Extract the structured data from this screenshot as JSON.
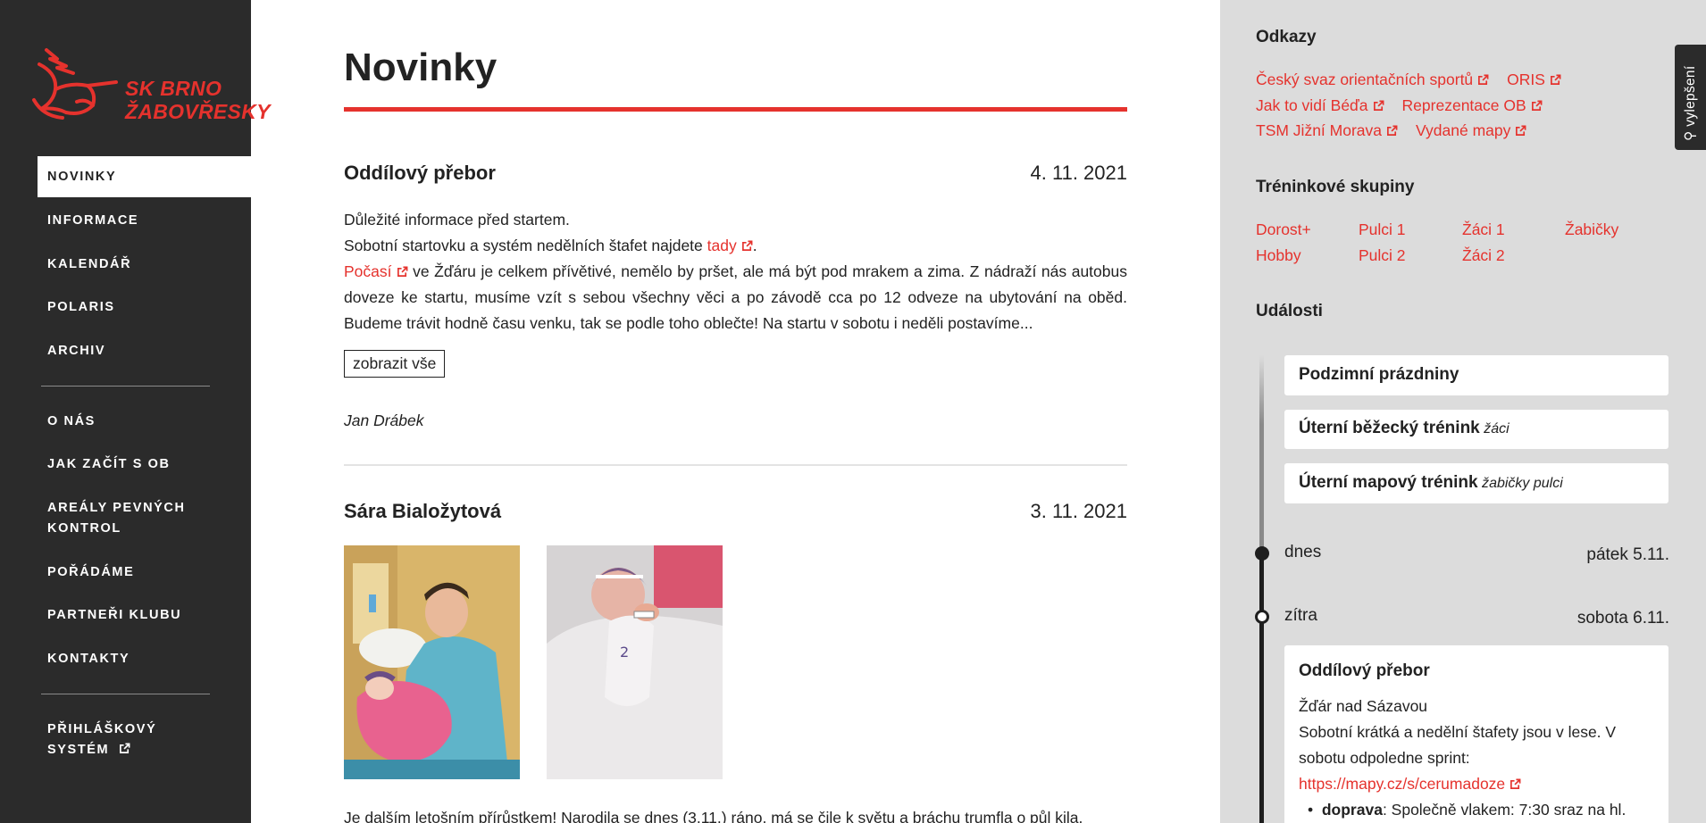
{
  "sidebar": {
    "logo_text_line1": "SK BRNO",
    "logo_text_line2": "ŽABOVŘESKY",
    "nav": [
      "NOVINKY",
      "INFORMACE",
      "KALENDÁŘ",
      "POLARIS",
      "ARCHIV",
      "O NÁS",
      "JAK ZAČÍT S OB",
      "AREÁLY PEVNÝCH",
      "KONTROL",
      "POŘÁDÁME",
      "PARTNEŘI KLUBU",
      "KONTAKTY",
      "PŘIHLÁŠKOVÝ",
      "SYSTÉM"
    ]
  },
  "main": {
    "title": "Novinky",
    "posts": [
      {
        "title": "Oddílový přebor",
        "date": "4. 11. 2021",
        "line1": "Důležité informace před startem.",
        "line2_before": "Sobotní startovku a systém nedělních štafet najdete ",
        "line2_link": "tady",
        "line2_after": ".",
        "line3_link": "Počasí",
        "line3_text": " ve Žďáru je celkem přívětivé, nemělo by pršet, ale má být pod mrakem a zima. Z nádraží nás autobus doveze ke startu, musíme vzít s sebou všechny věci a po závodě cca po 12 odveze na ubytování na oběd. Budeme trávit hodně času venku, tak se podle toho oblečte! Na startu v sobotu i neděli postavíme...",
        "show_all": "zobrazit vše",
        "author": "Jan Drábek"
      },
      {
        "title": "Sára Bialožytová",
        "date": "3. 11. 2021",
        "body": "Je dalším letošním přírůstkem! Narodila se dnes (3.11.) ráno, má se čile k světu a bráchu trumfla o půl kila."
      }
    ]
  },
  "aside": {
    "links_heading": "Odkazy",
    "links": [
      [
        "Český svaz orientačních sportů",
        "ORIS"
      ],
      [
        "Jak to vidí Béďa",
        "Reprezentace OB"
      ],
      [
        "TSM Jižní Morava",
        "Vydané mapy"
      ]
    ],
    "groups_heading": "Tréninkové skupiny",
    "groups": [
      "Dorost+",
      "Pulci 1",
      "Žáci 1",
      "Žabičky",
      "Hobby",
      "Pulci 2",
      "Žáci 2"
    ],
    "events_heading": "Události",
    "events": [
      {
        "title": "Podzimní prázdniny",
        "sub": ""
      },
      {
        "title": "Úterní běžecký trénink",
        "sub": "žáci"
      },
      {
        "title": "Úterní mapový trénink",
        "sub": "žabičky pulci"
      }
    ],
    "today_label": "dnes",
    "today_date": "pátek 5.11.",
    "tomorrow_label": "zítra",
    "tomorrow_date": "sobota 6.11.",
    "event_detail": {
      "title": "Oddílový přebor",
      "place": "Žďár nad Sázavou",
      "text": "Sobotní krátká a nedělní štafety jsou v lese. V sobotu odpoledne sprint:",
      "link": "https://mapy.cz/s/cerumadoze",
      "bullet_label": "doprava",
      "bullet_text": ": Společně vlakem: 7:30 sraz na hl."
    }
  },
  "feedback_tab": "vylepšení",
  "colors": {
    "accent": "#e5322d",
    "sidebar_bg": "#2b2b2b",
    "aside_bg": "#dcdcdc"
  }
}
